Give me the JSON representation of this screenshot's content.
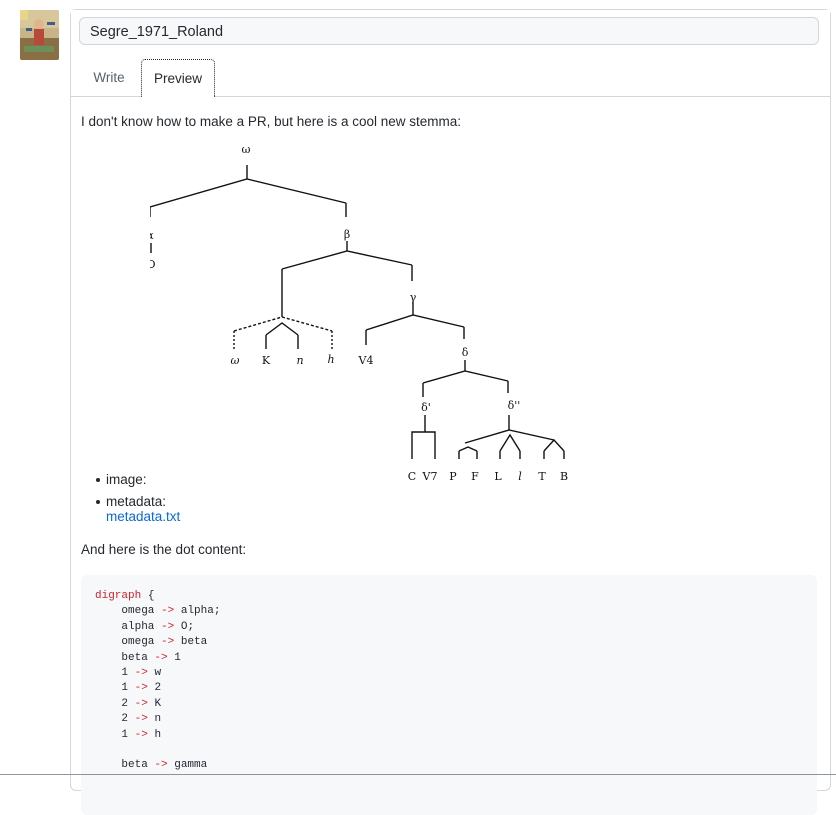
{
  "issue_title": "Segre_1971_Roland",
  "tabs": {
    "write": "Write",
    "preview": "Preview"
  },
  "comment": {
    "intro": "I don't know how to make a PR, but here is a cool new stemma:",
    "bullets": {
      "image": "image:",
      "metadata": "metadata:"
    },
    "metadata_link": "metadata.txt",
    "dot_intro": "And here is the dot content:"
  },
  "stemma_labels": {
    "omega": "ω",
    "alpha": "α",
    "o": "O",
    "beta": "β",
    "gamma": "γ",
    "delta": "δ",
    "delta1": "δ'",
    "delta2": "δ''",
    "w": "ω",
    "K": "K",
    "n": "n",
    "h": "h",
    "V4": "V4",
    "C": "C",
    "V7": "V7",
    "P": "P",
    "F": "F",
    "L": "L",
    "l": "l",
    "T": "T",
    "B": "B"
  },
  "code": {
    "keyword": "digraph",
    "open": " {",
    "lines": [
      {
        "left": "omega",
        "right": "alpha;"
      },
      {
        "left": "alpha",
        "right": "O;"
      },
      {
        "left": "omega",
        "right": "beta"
      },
      {
        "left": "beta",
        "right": "1"
      },
      {
        "left": "1",
        "right": "w"
      },
      {
        "left": "1",
        "right": "2"
      },
      {
        "left": "2",
        "right": "K"
      },
      {
        "left": "2",
        "right": "n"
      },
      {
        "left": "1",
        "right": "h"
      },
      {
        "left": "",
        "right": ""
      },
      {
        "left": "beta",
        "right": "gamma"
      }
    ],
    "arrow": "->"
  }
}
